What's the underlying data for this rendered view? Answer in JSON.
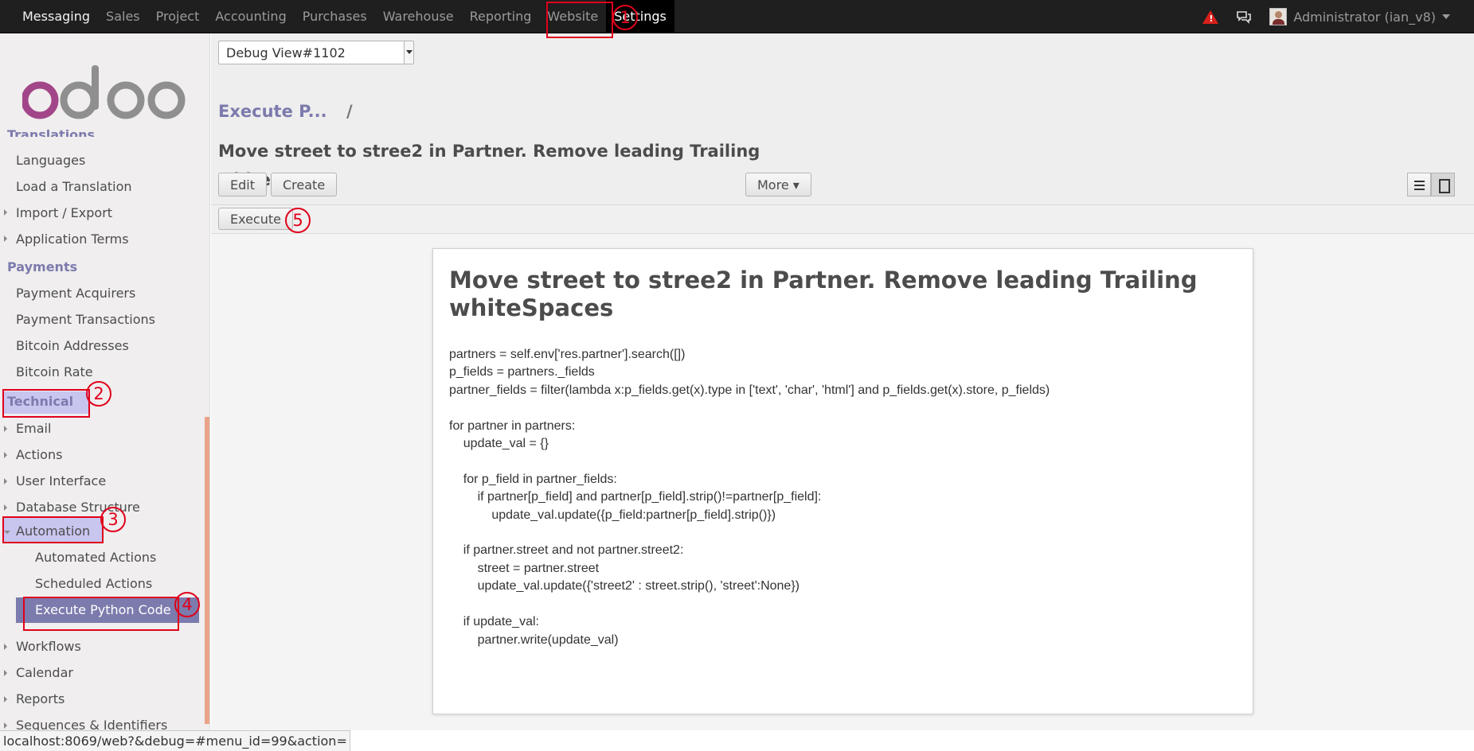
{
  "topbar": {
    "menu": [
      "Messaging",
      "Sales",
      "Project",
      "Accounting",
      "Purchases",
      "Warehouse",
      "Reporting",
      "Website",
      "Settings"
    ],
    "selected": "Settings",
    "user_label": "Administrator (ian_v8)",
    "warning_symbol": "!",
    "icons": [
      "warning-icon",
      "chat-icon",
      "avatar",
      "caret-down-icon"
    ],
    "warning_color": "#d9201c"
  },
  "logo": {
    "text": "odoo",
    "colors": [
      "#a24689",
      "#8f8f8f"
    ]
  },
  "sidebar": {
    "cut_section": "Translations",
    "translations_items": [
      "Languages",
      "Load a Translation",
      "Import / Export",
      "Application Terms"
    ],
    "payments_section": "Payments",
    "payments_items": [
      "Payment Acquirers",
      "Payment Transactions",
      "Bitcoin Addresses",
      "Bitcoin Rate"
    ],
    "technical_section": "Technical",
    "technical_items": [
      "Email",
      "Actions",
      "User Interface",
      "Database Structure",
      "Automation"
    ],
    "automation_items": [
      "Automated Actions",
      "Scheduled Actions",
      "Execute Python Code"
    ],
    "more_items": [
      "Workflows",
      "Calendar",
      "Reports",
      "Sequences & Identifiers"
    ],
    "active_item": "Execute Python Code",
    "accent_color": "#7c7bad"
  },
  "header": {
    "debug_select_value": "Debug View#1102",
    "breadcrumb": "Execute P...",
    "breadcrumb_sep": "/",
    "record_title": "Move street to stree2 in Partner. Remove leading Trailing whiteSpaces",
    "buttons": {
      "edit": "Edit",
      "create": "Create",
      "more": "More ▾"
    },
    "view_modes": [
      "list-view-icon",
      "form-view-icon"
    ]
  },
  "actionbar": {
    "execute": "Execute"
  },
  "sheet": {
    "title": "Move street to stree2 in Partner. Remove leading Trailing whiteSpaces",
    "code": "partners = self.env['res.partner'].search([])\np_fields = partners._fields\npartner_fields = filter(lambda x:p_fields.get(x).type in ['text', 'char', 'html'] and p_fields.get(x).store, p_fields)\n\nfor partner in partners:\n    update_val = {}\n\n    for p_field in partner_fields:\n        if partner[p_field] and partner[p_field].strip()!=partner[p_field]:\n            update_val.update({p_field:partner[p_field].strip()})\n\n    if partner.street and not partner.street2:\n        street = partner.street\n        update_val.update({'street2' : street.strip(), 'street':None})\n\n    if update_val:\n        partner.write(update_val)"
  },
  "statusbar": {
    "url": "localhost:8069/web?&debug=#menu_id=99&action="
  },
  "annotations": [
    "1",
    "2",
    "3",
    "4",
    "5"
  ],
  "annotation_color": "#e0001b"
}
